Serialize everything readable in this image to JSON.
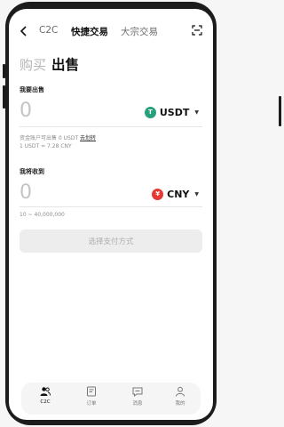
{
  "nav": {
    "tabs": [
      {
        "label": "C2C"
      },
      {
        "label": "快捷交易"
      },
      {
        "label": "大宗交易"
      }
    ]
  },
  "mode": {
    "buy": "购买",
    "sell": "出售"
  },
  "sell_section": {
    "label": "我要出售",
    "amount": "0",
    "currency": "USDT",
    "hint_prefix": "资金账户可出售 0 USDT",
    "hint_link": "去划转",
    "rate": "1 USDT = 7.28 CNY"
  },
  "receive_section": {
    "label": "我将收到",
    "amount": "0",
    "currency": "CNY",
    "range": "10 ~ 40,000,000"
  },
  "pay_button": "选择支付方式",
  "tabbar": {
    "items": [
      {
        "label": "C2C"
      },
      {
        "label": "订单"
      },
      {
        "label": "消息"
      },
      {
        "label": "我的"
      }
    ]
  },
  "colors": {
    "usdt": "#26a17b",
    "cny": "#e53935"
  }
}
